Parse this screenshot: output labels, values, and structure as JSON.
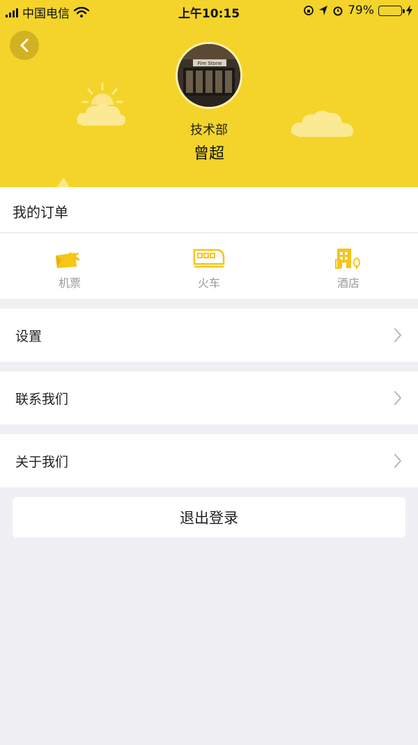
{
  "status_bar": {
    "carrier": "中国电信",
    "time": "上午10:15",
    "battery_percent_text": "79%",
    "battery_level": 0.79
  },
  "profile": {
    "department": "技术部",
    "name": "曾超",
    "avatar_text": "Fire Stone"
  },
  "orders": {
    "title": "我的订单",
    "items": [
      {
        "label": "机票",
        "icon": "flight-ticket-icon"
      },
      {
        "label": "火车",
        "icon": "train-icon"
      },
      {
        "label": "酒店",
        "icon": "hotel-icon"
      }
    ]
  },
  "menu": {
    "settings": "设置",
    "contact": "联系我们",
    "about": "关于我们"
  },
  "logout_label": "退出登录",
  "colors": {
    "brand_yellow": "#f4d42a",
    "icon_yellow": "#f5c518",
    "background": "#efeff4"
  }
}
